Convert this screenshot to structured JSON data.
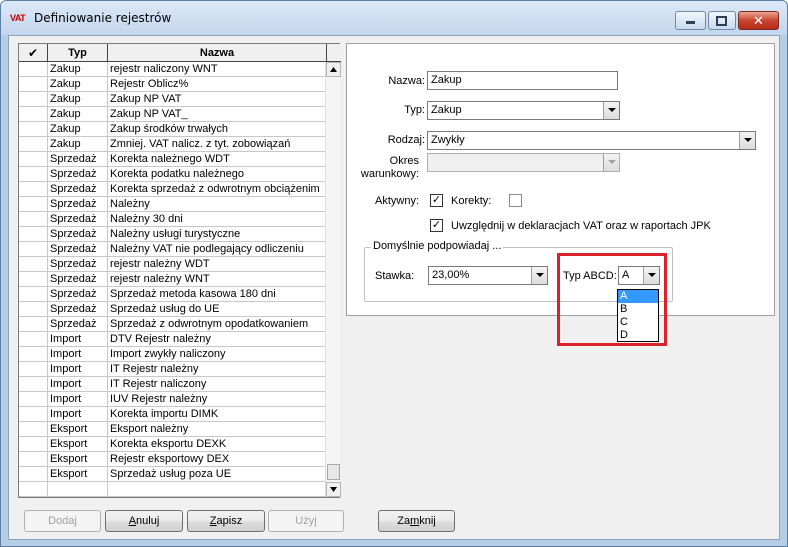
{
  "window": {
    "title": "Definiowanie rejestrów",
    "icon_text": "VAT",
    "controls": {
      "minimize": "minimize-icon",
      "maximize": "maximize-icon",
      "close": "✕"
    }
  },
  "grid": {
    "columns": {
      "check": "✔",
      "typ": "Typ",
      "nazwa": "Nazwa"
    },
    "rows": [
      {
        "typ": "Zakup",
        "nazwa": "rejestr naliczony WNT"
      },
      {
        "typ": "Zakup",
        "nazwa": "Rejestr Oblicz%"
      },
      {
        "typ": "Zakup",
        "nazwa": "Zakup NP VAT"
      },
      {
        "typ": "Zakup",
        "nazwa": "Zakup NP VAT_"
      },
      {
        "typ": "Zakup",
        "nazwa": "Zakup środków trwałych"
      },
      {
        "typ": "Zakup",
        "nazwa": "Zmniej. VAT nalicz. z tyt. zobowiązań"
      },
      {
        "typ": "Sprzedaż",
        "nazwa": "Korekta należnego WDT"
      },
      {
        "typ": "Sprzedaż",
        "nazwa": "Korekta podatku należnego"
      },
      {
        "typ": "Sprzedaż",
        "nazwa": "Korekta sprzedaż z odwrotnym obciążenim"
      },
      {
        "typ": "Sprzedaż",
        "nazwa": "Należny"
      },
      {
        "typ": "Sprzedaż",
        "nazwa": "Należny 30 dni"
      },
      {
        "typ": "Sprzedaż",
        "nazwa": "Należny usługi turystyczne"
      },
      {
        "typ": "Sprzedaż",
        "nazwa": "Należny VAT nie podlegający odliczeniu"
      },
      {
        "typ": "Sprzedaż",
        "nazwa": "rejestr należny WDT"
      },
      {
        "typ": "Sprzedaż",
        "nazwa": "rejestr należny WNT"
      },
      {
        "typ": "Sprzedaż",
        "nazwa": "Sprzedaż metoda kasowa 180 dni"
      },
      {
        "typ": "Sprzedaż",
        "nazwa": "Sprzedaż usług do UE"
      },
      {
        "typ": "Sprzedaż",
        "nazwa": "Sprzedaż z odwrotnym opodatkowaniem"
      },
      {
        "typ": "Import",
        "nazwa": "DTV Rejestr należny"
      },
      {
        "typ": "Import",
        "nazwa": "Import zwykły naliczony"
      },
      {
        "typ": "Import",
        "nazwa": "IT Rejestr należny"
      },
      {
        "typ": "Import",
        "nazwa": "IT Rejestr naliczony"
      },
      {
        "typ": "Import",
        "nazwa": "IUV Rejestr należny"
      },
      {
        "typ": "Import",
        "nazwa": "Korekta importu DIMK"
      },
      {
        "typ": "Eksport",
        "nazwa": "Eksport należny"
      },
      {
        "typ": "Eksport",
        "nazwa": "Korekta eksportu DEXK"
      },
      {
        "typ": "Eksport",
        "nazwa": "Rejestr eksportowy DEX"
      },
      {
        "typ": "Eksport",
        "nazwa": "Sprzedaż usług poza UE"
      },
      {
        "typ": "",
        "nazwa": ""
      }
    ]
  },
  "form": {
    "nazwa_label": "Nazwa:",
    "nazwa_value": "Zakup",
    "typ_label": "Typ:",
    "typ_value": "Zakup",
    "rodzaj_label": "Rodzaj:",
    "rodzaj_value": "Zwykły",
    "okres_label_1": "Okres",
    "okres_label_2": "warunkowy:",
    "okres_value": "",
    "aktywny_label": "Aktywny:",
    "aktywny_checked": "✓",
    "korekty_label": "Korekty:",
    "korekty_checked": "",
    "uwzgl_label": "Uwzględnij w deklaracjach VAT oraz w raportach JPK",
    "uwzgl_checked": "✓",
    "group_title": "Domyślnie podpowiadaj ...",
    "stawka_label": "Stawka:",
    "stawka_value": "23,00%",
    "typabcd_label": "Typ ABCD:",
    "typabcd_value": "A",
    "typabcd_options": [
      "A",
      "B",
      "C",
      "D"
    ],
    "highlight_color": "#d9232a",
    "selected_option_color": "#3399ff"
  },
  "buttons": {
    "dodaj": "Dodaj",
    "anuluj": "Anuluj",
    "zapisz": "Zapisz",
    "uzyj": "Użyj",
    "zamknij": "Zamknij"
  }
}
